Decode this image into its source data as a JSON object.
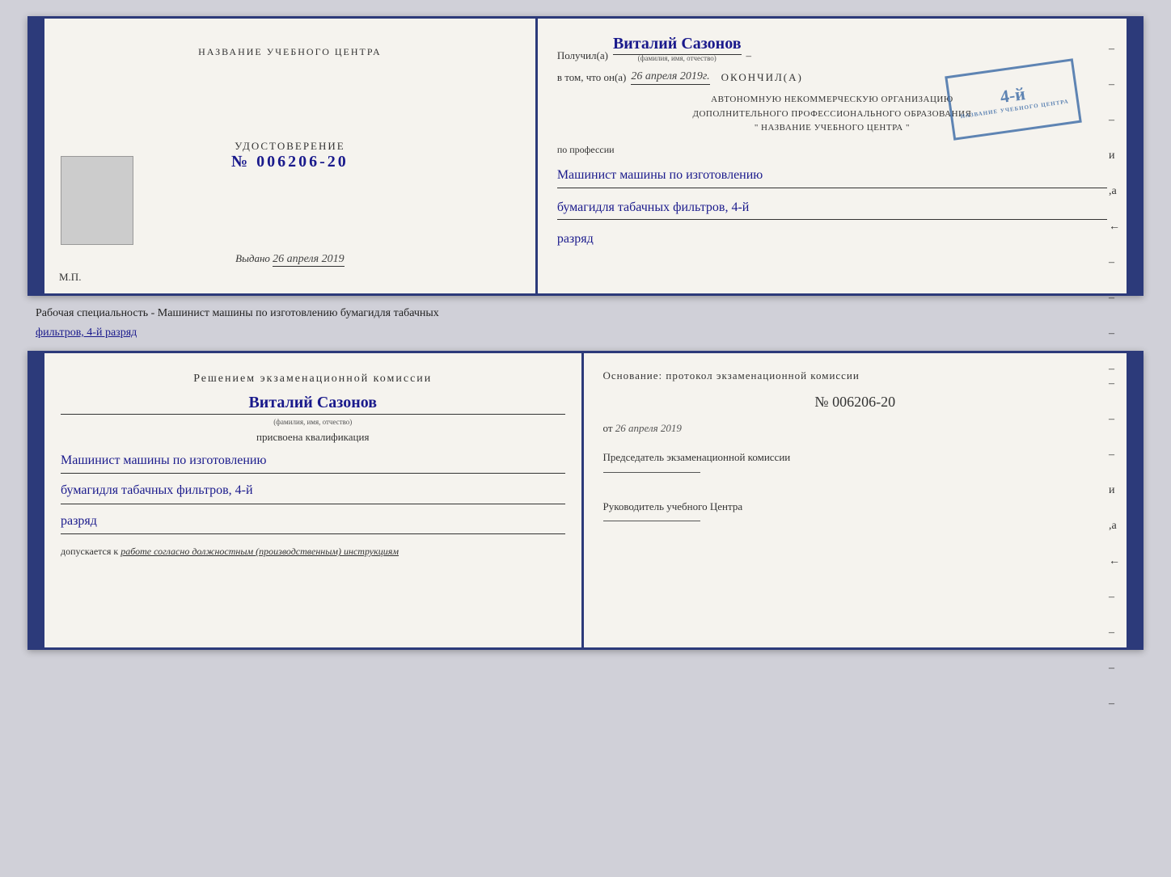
{
  "top_cert": {
    "left": {
      "org_title": "НАЗВАНИЕ УЧЕБНОГО ЦЕНТРА",
      "cert_label": "УДОСТОВЕРЕНИЕ",
      "cert_number": "№ 006206-20",
      "issued_prefix": "Выдано",
      "issued_date": "26 апреля 2019",
      "mp": "М.П."
    },
    "right": {
      "received_prefix": "Получил(а)",
      "recipient_name": "Виталий Сазонов",
      "recipient_sublabel": "(фамилия, имя, отчество)",
      "vtom_prefix": "в том, что он(а)",
      "vtom_date": "26 апреля 2019г.",
      "finished_label": "окончил(а)",
      "stamp_number": "4-й",
      "org_line1": "АВТОНОМНУЮ НЕКОММЕРЧЕСКУЮ ОРГАНИЗАЦИЮ",
      "org_line2": "ДОПОЛНИТЕЛЬНОГО ПРОФЕССИОНАЛЬНОГО ОБРАЗОВАНИЯ",
      "org_line3": "\" НАЗВАНИЕ УЧЕБНОГО ЦЕНТРА \"",
      "profession_prefix": "по профессии",
      "profession_text": "Машинист машины по изготовлению",
      "profession_text2": "бумагидля табачных фильтров, 4-й",
      "profession_text3": "разряд",
      "dashes": [
        "-",
        "-",
        "-",
        "и",
        ",а",
        "←",
        "-",
        "-",
        "-",
        "-"
      ]
    }
  },
  "separator_text": "Рабочая специальность - Машинист машины по изготовлению бумагидля табачных",
  "separator_underline": "фильтров, 4-й разряд",
  "bottom_cert": {
    "left": {
      "decision_title": "Решением экзаменационной комиссии",
      "person_name": "Виталий Сазонов",
      "person_sublabel": "(фамилия, имя, отчество)",
      "assigned_label": "присвоена квалификация",
      "qual_line1": "Машинист машины по изготовлению",
      "qual_line2": "бумагидля табачных фильтров, 4-й",
      "qual_line3": "разряд",
      "admitted_prefix": "допускается к",
      "admitted_text": "работе согласно должностным (производственным) инструкциям"
    },
    "right": {
      "osnov_label": "Основание: протокол экзаменационной комиссии",
      "protocol_number": "№ 006206-20",
      "ot_prefix": "от",
      "ot_date": "26 апреля 2019",
      "chairman_label": "Председатель экзаменационной комиссии",
      "head_label": "Руководитель учебного Центра",
      "dashes": [
        "-",
        "-",
        "-",
        "и",
        ",а",
        "←",
        "-",
        "-",
        "-",
        "-"
      ]
    }
  }
}
